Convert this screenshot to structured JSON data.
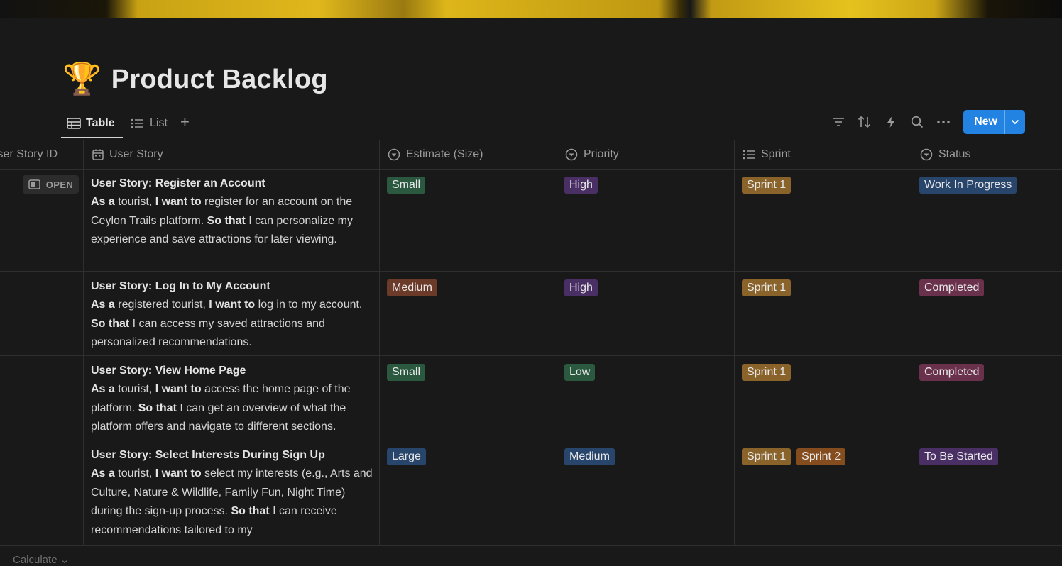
{
  "page": {
    "icon": "🏆",
    "title": "Product Backlog"
  },
  "views": [
    {
      "label": "Table",
      "icon": "table-icon",
      "active": true
    },
    {
      "label": "List",
      "icon": "list-icon",
      "active": false
    }
  ],
  "add_view_label": "+",
  "toolbar": {
    "icons": [
      "filter-icon",
      "sort-icon",
      "automation-lightning-icon",
      "search-icon",
      "more-options-icon"
    ],
    "new_label": "New"
  },
  "columns": [
    {
      "label": "User Story ID",
      "icon": "none"
    },
    {
      "label": "User Story",
      "icon": "calendar-icon"
    },
    {
      "label": "Estimate (Size)",
      "icon": "select-icon"
    },
    {
      "label": "Priority",
      "icon": "select-icon"
    },
    {
      "label": "Sprint",
      "icon": "multi-select-icon"
    },
    {
      "label": "Status",
      "icon": "status-icon"
    }
  ],
  "open_label": "OPEN",
  "rows": [
    {
      "title": "User Story: Register an Account",
      "as_label": "As a",
      "as_text": " tourist, ",
      "want_label": "I want to",
      "want_text": " register for an account on the Ceylon Trails platform. ",
      "so_label": "So that",
      "so_text": " I can personalize my experience and save attractions for later viewing.",
      "estimate": "Small",
      "priority": "High",
      "sprints": [
        "Sprint 1"
      ],
      "status": "Work In Progress"
    },
    {
      "title": "User Story: Log In to My Account",
      "as_label": "As a",
      "as_text": " registered tourist, ",
      "want_label": "I want to",
      "want_text": " log in to my account. ",
      "so_label": "So that",
      "so_text": " I can access my saved attractions and personalized recommendations.",
      "estimate": "Medium",
      "priority": "High",
      "sprints": [
        "Sprint 1"
      ],
      "status": "Completed"
    },
    {
      "title": "User Story: View Home Page",
      "as_label": "As a",
      "as_text": " tourist, ",
      "want_label": "I want to",
      "want_text": " access the home page of the platform. ",
      "so_label": "So that",
      "so_text": " I can get an overview of what the platform offers and navigate to different sections.",
      "estimate": "Small",
      "priority": "Low",
      "sprints": [
        "Sprint 1"
      ],
      "status": "Completed"
    },
    {
      "title": "User Story: Select Interests During Sign Up",
      "as_label": "As a",
      "as_text": " tourist, ",
      "want_label": "I want to",
      "want_text": " select my interests (e.g., Arts and Culture, Nature & Wildlife, Family Fun, Night Time) during the sign-up process. ",
      "so_label": "So that",
      "so_text": " I can receive recommendations tailored to my",
      "estimate": "Large",
      "priority": "Medium",
      "sprints": [
        "Sprint 1",
        "Sprint 2"
      ],
      "status": "To Be Started"
    }
  ],
  "tag_colors": {
    "Small": "#2b593f",
    "Medium": "#6b3a28",
    "Large": "#28456c",
    "High": "#492f64",
    "Low": "#2b593f",
    "Sprint 1": "#89632a",
    "Sprint 2": "#854c1d",
    "Work In Progress": "#28456c",
    "Completed": "#69314c",
    "To Be Started": "#492f64"
  },
  "priority_colors": {
    "Medium": "#28456c"
  },
  "footer": {
    "calculate_label": "Calculate ⌄"
  }
}
